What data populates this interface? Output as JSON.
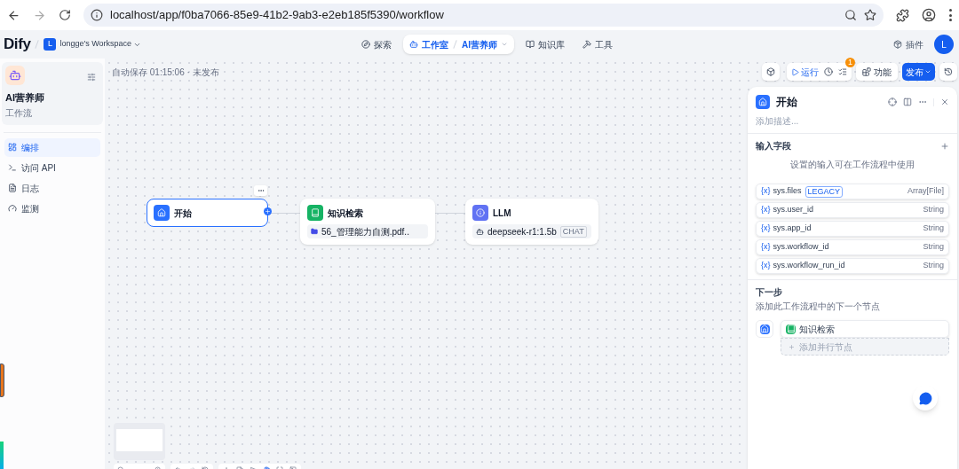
{
  "browser": {
    "url": "localhost/app/f0ba7066-85e9-41b2-9ab3-e2eb185f5390/workflow"
  },
  "header": {
    "logo": "Dify",
    "workspace_avatar": "L",
    "workspace": "longge's Workspace",
    "nav": [
      {
        "kind": "explore",
        "label": "探索",
        "selected": false
      },
      {
        "kind": "studio",
        "label": "工作室",
        "selected": true,
        "breadcrumb": "AI营养师"
      },
      {
        "kind": "knowledge",
        "label": "知识库",
        "selected": false
      },
      {
        "kind": "tools",
        "label": "工具",
        "selected": false
      }
    ],
    "plugins": "插件",
    "user_avatar": "L"
  },
  "sidebar": {
    "app_name": "AI营养师",
    "app_type": "工作流",
    "items": [
      {
        "kind": "orchestrate",
        "label": "编排",
        "selected": true
      },
      {
        "kind": "api",
        "label": "访问 API",
        "selected": false
      },
      {
        "kind": "logs",
        "label": "日志",
        "selected": false
      },
      {
        "kind": "monitor",
        "label": "监测",
        "selected": false
      }
    ]
  },
  "canvas": {
    "autosave": "自动保存 01:15:06 · 未发布",
    "run": "运行",
    "checklist_badge": "1",
    "features": "功能",
    "publish": "发布",
    "nodes": [
      {
        "kind": "start",
        "title": "开始",
        "selected": true
      },
      {
        "kind": "knowledge",
        "title": "知识检索",
        "selected": false,
        "detail": "56_管理能力自测.pdf.."
      },
      {
        "kind": "llm",
        "title": "LLM",
        "selected": false,
        "detail": "deepseek-r1:1.5b",
        "tag": "CHAT"
      }
    ]
  },
  "panel": {
    "title": "开始",
    "description_placeholder": "添加描述...",
    "inputs_title": "输入字段",
    "inputs_hint": "设置的输入可在工作流程中使用",
    "variables": [
      {
        "icon": "{x}",
        "name": "sys.files",
        "badge": "LEGACY",
        "type": "Array[File]"
      },
      {
        "icon": "{x}",
        "name": "sys.user_id",
        "type": "String"
      },
      {
        "icon": "{x}",
        "name": "sys.app_id",
        "type": "String"
      },
      {
        "icon": "{x}",
        "name": "sys.workflow_id",
        "type": "String"
      },
      {
        "icon": "{x}",
        "name": "sys.workflow_run_id",
        "type": "String"
      }
    ],
    "next_title": "下一步",
    "next_hint": "添加此工作流程中的下一个节点",
    "next_node": "知识检索",
    "add_parallel": "添加并行节点"
  }
}
